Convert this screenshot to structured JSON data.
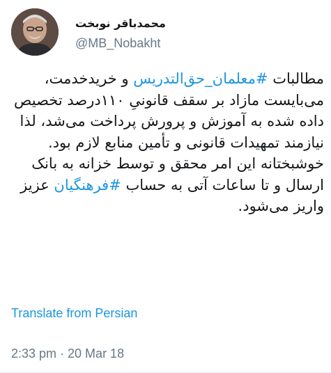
{
  "author": {
    "display_name": "محمدباقر نوبخت",
    "handle": "@MB_Nobakht",
    "avatar_icon": "profile-photo-icon"
  },
  "tweet": {
    "para1": {
      "t1": "مطالبات ",
      "hashtag1": "#معلمان_حق‌التدریس",
      "t2": " و خریدخدمت، می‌بایست مازاد بر سقف قانونیِ ۱۱۰درصد تخصیص داده شده به آموزش و پرورش پرداخت می‌شد، لذا نیازمند تمهیدات قانونی و تأمین منابع لازم بود."
    },
    "para2": {
      "t1": "خوشبختانه این امر محقق و توسط خزانه به بانک ارسال و تا ساعات آتی به حساب ",
      "hashtag2": "#فرهنگیان",
      "t2": " عزیز واریز می‌شود."
    }
  },
  "translate_label": "Translate from Persian",
  "timestamp": "2:33 pm · 20 Mar 18",
  "colors": {
    "link": "#1b95e0",
    "text": "#14171a",
    "muted": "#657786"
  }
}
